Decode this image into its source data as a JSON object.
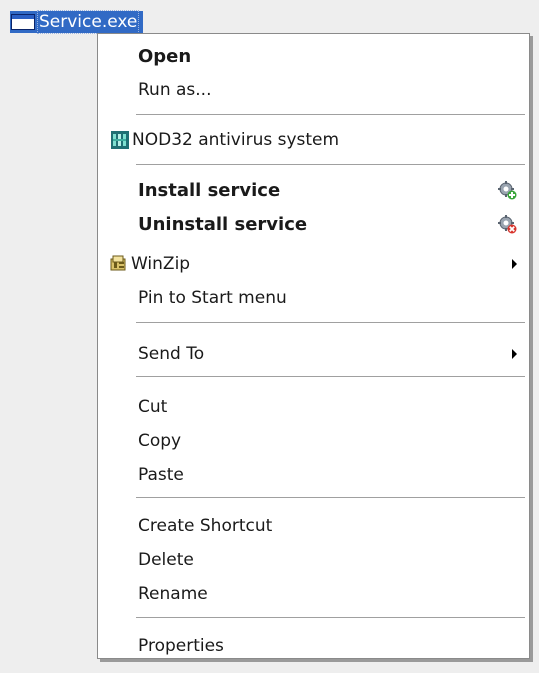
{
  "file": {
    "name": "Service.exe",
    "icon": "application-window-icon"
  },
  "menu": {
    "open": "Open",
    "run_as": "Run as...",
    "nod32": "NOD32 antivirus system",
    "install_service": "Install service",
    "uninstall_service": "Uninstall service",
    "winzip": "WinZip",
    "pin_start": "Pin to Start menu",
    "send_to": "Send To",
    "cut": "Cut",
    "copy": "Copy",
    "paste": "Paste",
    "create_shortcut": "Create Shortcut",
    "delete": "Delete",
    "rename": "Rename",
    "properties": "Properties"
  },
  "icons": {
    "nod32": "nod32-icon",
    "install": "gear-add-icon",
    "uninstall": "gear-remove-icon",
    "winzip": "winzip-icon",
    "submenu": "submenu-arrow-icon"
  },
  "colors": {
    "selection": "#316ac5",
    "menu_bg": "#ffffff",
    "separator": "#a0a0a0",
    "desktop_bg": "#eeeeee"
  }
}
